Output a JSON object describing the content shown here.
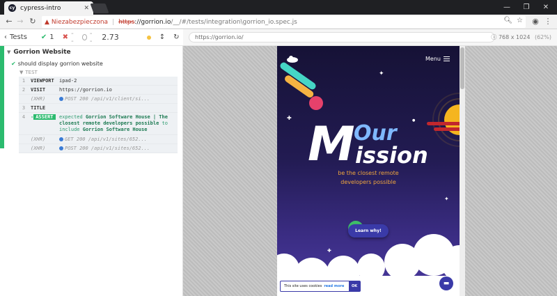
{
  "browser": {
    "tab_title": "cypress-intro",
    "tab_favicon": "cy",
    "tab_close": "✕",
    "insecure_label": "Niezabezpieczona",
    "url_scheme": "https",
    "url_host": "://gorrion.io",
    "url_path": "/__/#/tests/integration\\gorrion_io.spec.js",
    "window_controls": [
      "—",
      "❐",
      "✕"
    ],
    "nav": {
      "back": "←",
      "forward": "→",
      "reload": "↻"
    }
  },
  "reporter": {
    "tests_label": "Tests",
    "passed": "1",
    "failed": "--",
    "pending": "--",
    "duration": "2.73",
    "suite_title": "Gorrion Website",
    "test_title": "should display gorrion website",
    "hook_label": "TEST",
    "commands": [
      {
        "num": "1",
        "name": "VIEWPORT",
        "message": "ipad-2",
        "faded": false
      },
      {
        "num": "2",
        "name": "VISIT",
        "message": "https://gorrion.io",
        "faded": false
      },
      {
        "num": "",
        "name": "(XHR)",
        "message": "POST 200 /api/v1/client/si...",
        "faded": true
      },
      {
        "num": "3",
        "name": "TITLE",
        "message": "",
        "faded": false
      },
      {
        "num": "",
        "name": "(XHR)",
        "message": "GET 200 /api/v1/sites/652...",
        "faded": true
      },
      {
        "num": "",
        "name": "(XHR)",
        "message": "POST 200 /api/v1/sites/652...",
        "faded": true
      }
    ],
    "assert": {
      "num": "4",
      "badge": "ASSERT",
      "expected": "expected",
      "subject": "Gorrion Software House | The closest remote developers possible",
      "to_include": "to include",
      "value": "Gorrion Software House"
    }
  },
  "runner": {
    "url": "https://gorrion.io/",
    "viewport": "768 x 1024",
    "scale": "(62%)"
  },
  "aut": {
    "menu_label": "Menu",
    "title_our": "Our",
    "title_m": "M",
    "title_ission": "ission",
    "subtitle_line1": "be the closest remote",
    "subtitle_line2": "developers possible",
    "cta": "Learn why!",
    "cookie_text": "This site uses cookies",
    "cookie_link": "read more",
    "cookie_ok": "OK"
  }
}
